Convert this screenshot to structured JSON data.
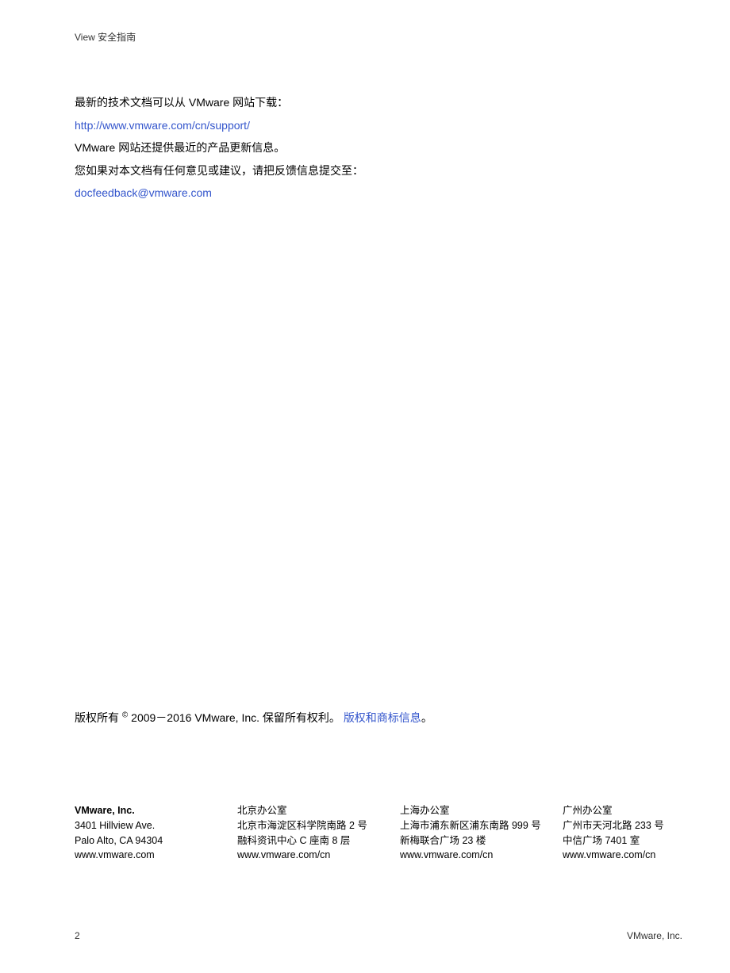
{
  "header": {
    "title": "View 安全指南"
  },
  "content": {
    "line1": "最新的技术文档可以从 VMware 网站下载：",
    "link1": "http://www.vmware.com/cn/support/",
    "line2": "VMware 网站还提供最近的产品更新信息。",
    "line3": "您如果对本文档有任何意见或建议，请把反馈信息提交至：",
    "link2": "docfeedback@vmware.com"
  },
  "copyright": {
    "prefix": "版权所有 ",
    "symbol": "©",
    "text": " 2009－2016 VMware, Inc. 保留所有权利。 ",
    "link": "版权和商标信息",
    "suffix": "。"
  },
  "addresses": [
    {
      "title": "VMware, Inc.",
      "lines": [
        "3401 Hillview Ave.",
        "Palo Alto, CA 94304",
        "www.vmware.com"
      ]
    },
    {
      "title": "北京办公室",
      "lines": [
        "北京市海淀区科学院南路 2 号",
        "融科资讯中心 C 座南 8 层",
        "www.vmware.com/cn"
      ]
    },
    {
      "title": "上海办公室",
      "lines": [
        "上海市浦东新区浦东南路 999 号",
        "新梅联合广场 23 楼",
        "www.vmware.com/cn"
      ]
    },
    {
      "title": "广州办公室",
      "lines": [
        "广州市天河北路 233 号",
        "中信广场 7401 室",
        "www.vmware.com/cn"
      ]
    }
  ],
  "footer": {
    "page": "2",
    "company": "VMware, Inc."
  }
}
